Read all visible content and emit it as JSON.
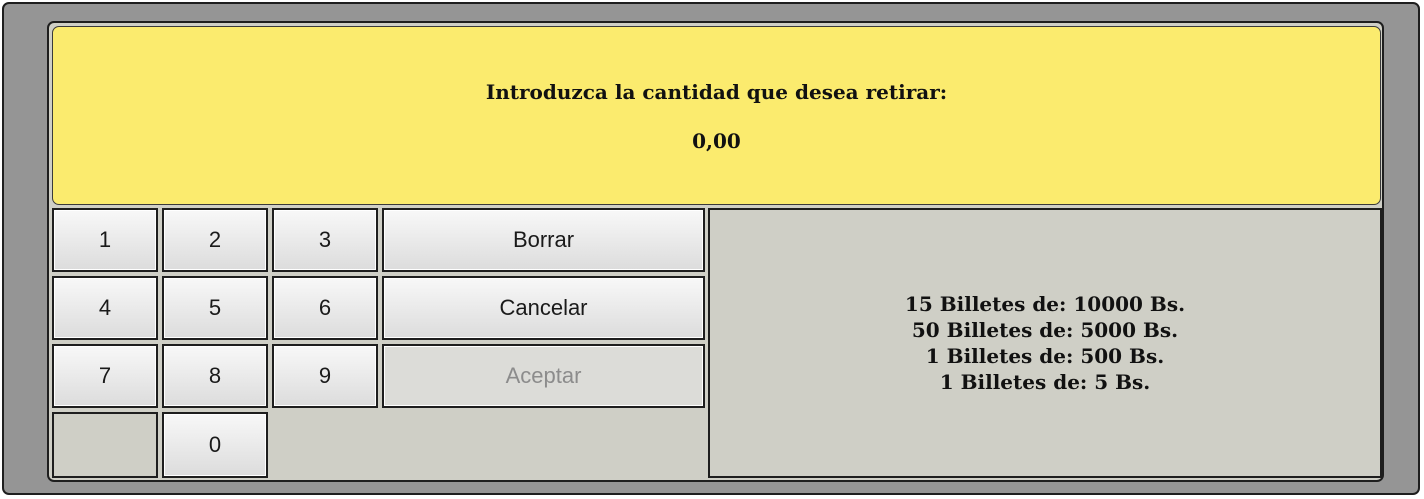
{
  "screen": {
    "prompt": "Introduzca la cantidad que desea retirar:",
    "amount": "0,00"
  },
  "keypad": {
    "k1": "1",
    "k2": "2",
    "k3": "3",
    "k4": "4",
    "k5": "5",
    "k6": "6",
    "k7": "7",
    "k8": "8",
    "k9": "9",
    "k0": "0"
  },
  "actions": {
    "clear": "Borrar",
    "cancel": "Cancelar",
    "accept": "Aceptar",
    "accept_disabled": true
  },
  "notes": [
    "15 Billetes de: 10000 Bs.",
    "50 Billetes de: 5000 Bs.",
    "1 Billetes de: 500 Bs.",
    "1 Billetes de: 5 Bs."
  ],
  "colors": {
    "screen_bg": "#fbeb6e",
    "panel_bg": "#cfcfc6",
    "frame_bg": "#959595"
  }
}
